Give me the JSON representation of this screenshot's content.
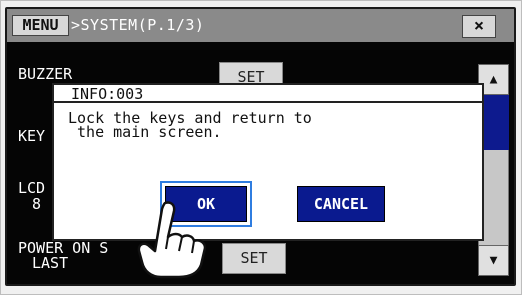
{
  "titlebar": {
    "menu_label": "MENU",
    "breadcrumb": ">SYSTEM(P.1/3)",
    "close_label": "×"
  },
  "settings": {
    "rows": [
      {
        "label": "BUZZER"
      },
      {
        "label": "KEY"
      },
      {
        "label_line1": "LCD",
        "label_line2": "8"
      },
      {
        "label_line1": "POWER ON S",
        "label_line2": "LAST"
      }
    ],
    "set_label": "SET"
  },
  "scrollbar": {
    "up_icon": "▲",
    "down_icon": "▼"
  },
  "dialog": {
    "title": "INFO:003",
    "message_line1": "Lock the keys and return to",
    "message_line2": " the main screen.",
    "ok_label": "OK",
    "cancel_label": "CANCEL"
  },
  "colors": {
    "title_bar": "#8a8a8a",
    "screen_bg": "#050505",
    "button_blue": "#0a1a8f",
    "focus_ring": "#2f7de0"
  }
}
